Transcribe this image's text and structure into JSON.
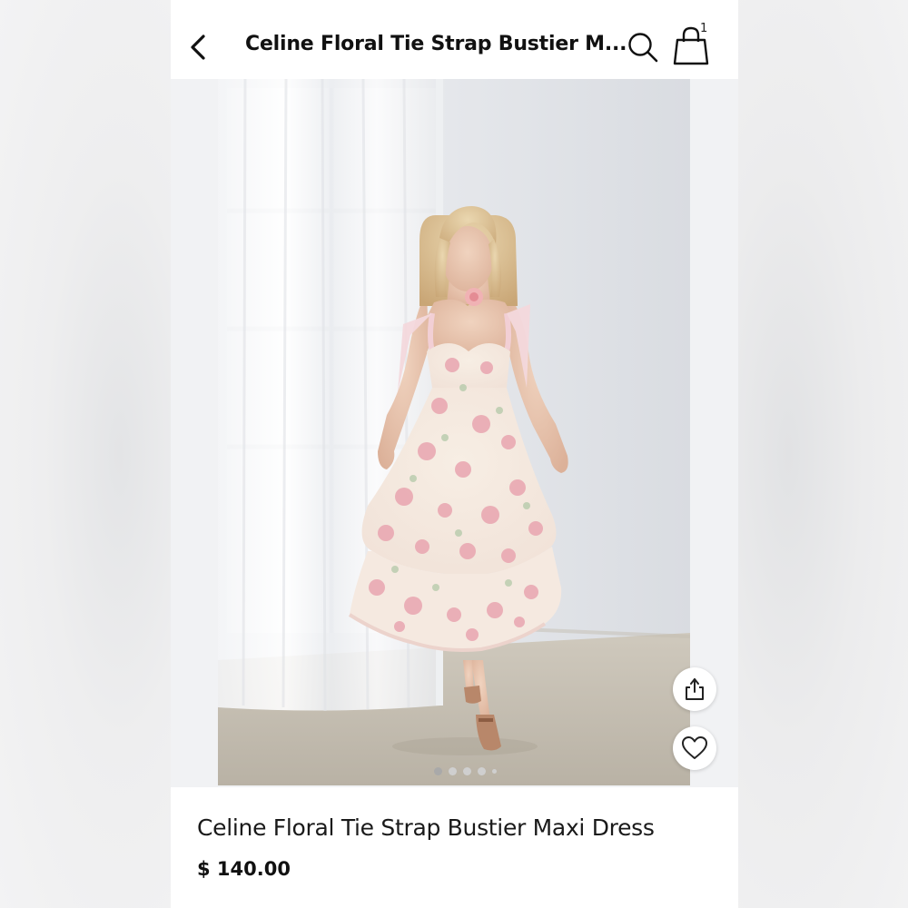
{
  "header": {
    "title": "Celine Floral Tie Strap Bustier M...",
    "back_icon": "chevron-left-icon",
    "search_icon": "search-icon",
    "bag_icon": "shopping-bag-icon",
    "bag_count": "1"
  },
  "gallery": {
    "image_alt": "Woman wearing floral tie strap bustier maxi dress",
    "dots_total": 5,
    "active_index": 0,
    "share_icon": "share-icon",
    "like_icon": "heart-icon"
  },
  "product": {
    "name": "Celine Floral Tie Strap Bustier Maxi Dress",
    "price": "$ 140.00"
  },
  "colors": {
    "text": "#111111",
    "background": "#ffffff",
    "gallery_bg": "#f1f2f4"
  }
}
